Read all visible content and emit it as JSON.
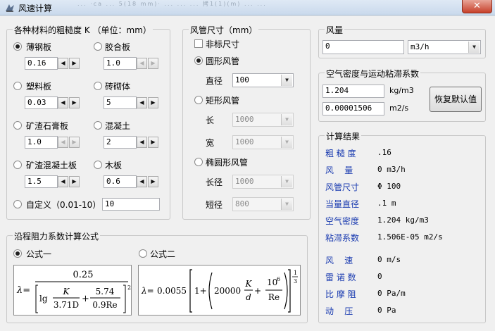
{
  "window": {
    "title": "风速计算",
    "blurred_bg_text": "...  ·ca  ... 5(18 mm)·  ...  ...  ... 拷1(1)(m)  ...  ...",
    "close_glyph": "✕"
  },
  "roughness": {
    "title": "各种材料的粗糙度 K  （单位：mm）",
    "materials": [
      {
        "label": "薄钢板",
        "value": "0.16",
        "selected": true,
        "enabled": true
      },
      {
        "label": "胶合板",
        "value": "1.0",
        "selected": false,
        "enabled": false
      },
      {
        "label": "塑料板",
        "value": "0.03",
        "selected": false,
        "enabled": true
      },
      {
        "label": "砖砌体",
        "value": "5",
        "selected": false,
        "enabled": true
      },
      {
        "label": "矿渣石膏板",
        "value": "1.0",
        "selected": false,
        "enabled": false
      },
      {
        "label": "混凝土",
        "value": "2",
        "selected": false,
        "enabled": true
      },
      {
        "label": "矿渣混凝土板",
        "value": "1.5",
        "selected": false,
        "enabled": true
      },
      {
        "label": "木板",
        "value": "0.6",
        "selected": false,
        "enabled": true
      }
    ],
    "custom_label": "自定义（0.01-10）",
    "custom_value": "10"
  },
  "duct": {
    "title": "风管尺寸（mm）",
    "nonstandard_label": "非标尺寸",
    "round_label": "圆形风管",
    "diameter_label": "直径",
    "diameter_value": "100",
    "rect_label": "矩形风管",
    "length_label": "长",
    "length_value": "1000",
    "width_label": "宽",
    "width_value": "1000",
    "ellipse_label": "椭圆形风管",
    "major_label": "长径",
    "major_value": "1000",
    "minor_label": "短径",
    "minor_value": "800"
  },
  "airflow": {
    "title": "风量",
    "value": "0",
    "unit": "m3/h"
  },
  "air": {
    "title": "空气密度与运动粘滞系数",
    "density_value": "1.204",
    "density_unit": "kg/m3",
    "viscosity_value": "0.00001506",
    "viscosity_unit": "m2/s",
    "reset_label": "恢复默认值"
  },
  "results": {
    "title": "计算结果",
    "rows": [
      {
        "label": "粗 糙 度",
        "value": ".16"
      },
      {
        "label": "风    量",
        "value": "0 m3/h"
      },
      {
        "label": "风管尺寸",
        "value": "Φ 100"
      },
      {
        "label": "当量直径",
        "value": ".1 m"
      },
      {
        "label": "空气密度",
        "value": "1.204 kg/m3"
      },
      {
        "label": "粘滞系数",
        "value": "1.506E-05 m2/s"
      },
      {
        "label": "风    速",
        "value": "0 m/s"
      },
      {
        "label": "雷 诺 数",
        "value": "0"
      },
      {
        "label": "比 摩 阻",
        "value": "0 Pa/m"
      },
      {
        "label": "动    压",
        "value": "0 Pa"
      }
    ]
  },
  "formula": {
    "title": "沿程阻力系数计算公式",
    "option1_label": "公式一",
    "option2_label": "公式二",
    "f1": {
      "lambda": "λ=",
      "num": "0.25",
      "lg": "lg",
      "k": "K",
      "d371": "3.71D",
      "plus": "+",
      "n574": "5.74",
      "re09": "0.9Re",
      "exp": "2"
    },
    "f2": {
      "lambda": "λ=",
      "coef": "0.0055",
      "one": "1+",
      "c20000": "20000",
      "k": "K",
      "d": "d",
      "plus": "+",
      "ten6": "10",
      "six": "6",
      "re": "Re",
      "exp_num": "1",
      "exp_den": "3"
    }
  }
}
